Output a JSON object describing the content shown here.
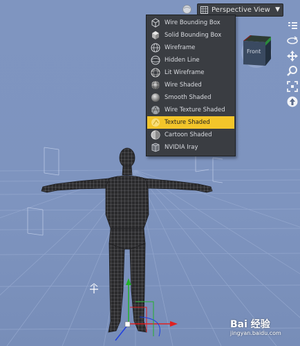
{
  "toolbar": {
    "view_select_label": "Perspective View",
    "globe_icon": "globe-icon",
    "dropdown_icon": "chevron-down-icon"
  },
  "drawstyle_menu": {
    "items": [
      {
        "label": "Wire Bounding Box",
        "icon": "wire-bounding-box-icon",
        "selected": false
      },
      {
        "label": "Solid Bounding Box",
        "icon": "solid-bounding-box-icon",
        "selected": false
      },
      {
        "label": "Wireframe",
        "icon": "wireframe-sphere-icon",
        "selected": false
      },
      {
        "label": "Hidden Line",
        "icon": "hidden-line-sphere-icon",
        "selected": false
      },
      {
        "label": "Lit Wireframe",
        "icon": "lit-wireframe-sphere-icon",
        "selected": false
      },
      {
        "label": "Wire Shaded",
        "icon": "wire-shaded-sphere-icon",
        "selected": false
      },
      {
        "label": "Smooth Shaded",
        "icon": "smooth-shaded-sphere-icon",
        "selected": false
      },
      {
        "label": "Wire Texture Shaded",
        "icon": "wire-texture-shaded-icon",
        "selected": false
      },
      {
        "label": "Texture Shaded",
        "icon": "texture-shaded-icon",
        "selected": true
      },
      {
        "label": "Cartoon Shaded",
        "icon": "cartoon-shaded-icon",
        "selected": false
      },
      {
        "label": "NVIDIA Iray",
        "icon": "nvidia-iray-icon",
        "selected": false
      }
    ]
  },
  "navigation_cube": {
    "face_label": "Front"
  },
  "right_tools": [
    "menu-icon",
    "orbit-icon",
    "pan-icon",
    "zoom-icon",
    "frame-icon",
    "reset-view-icon"
  ],
  "watermark": {
    "brand": "Bai 经验",
    "site": "jingyan.baidu.com"
  },
  "colors": {
    "viewport_bg": "#7f95c0",
    "menu_bg": "#3a3d42",
    "selected": "#f3c52a",
    "gizmo_x": "#e02020",
    "gizmo_y": "#22b02a",
    "gizmo_z": "#2040e0"
  }
}
